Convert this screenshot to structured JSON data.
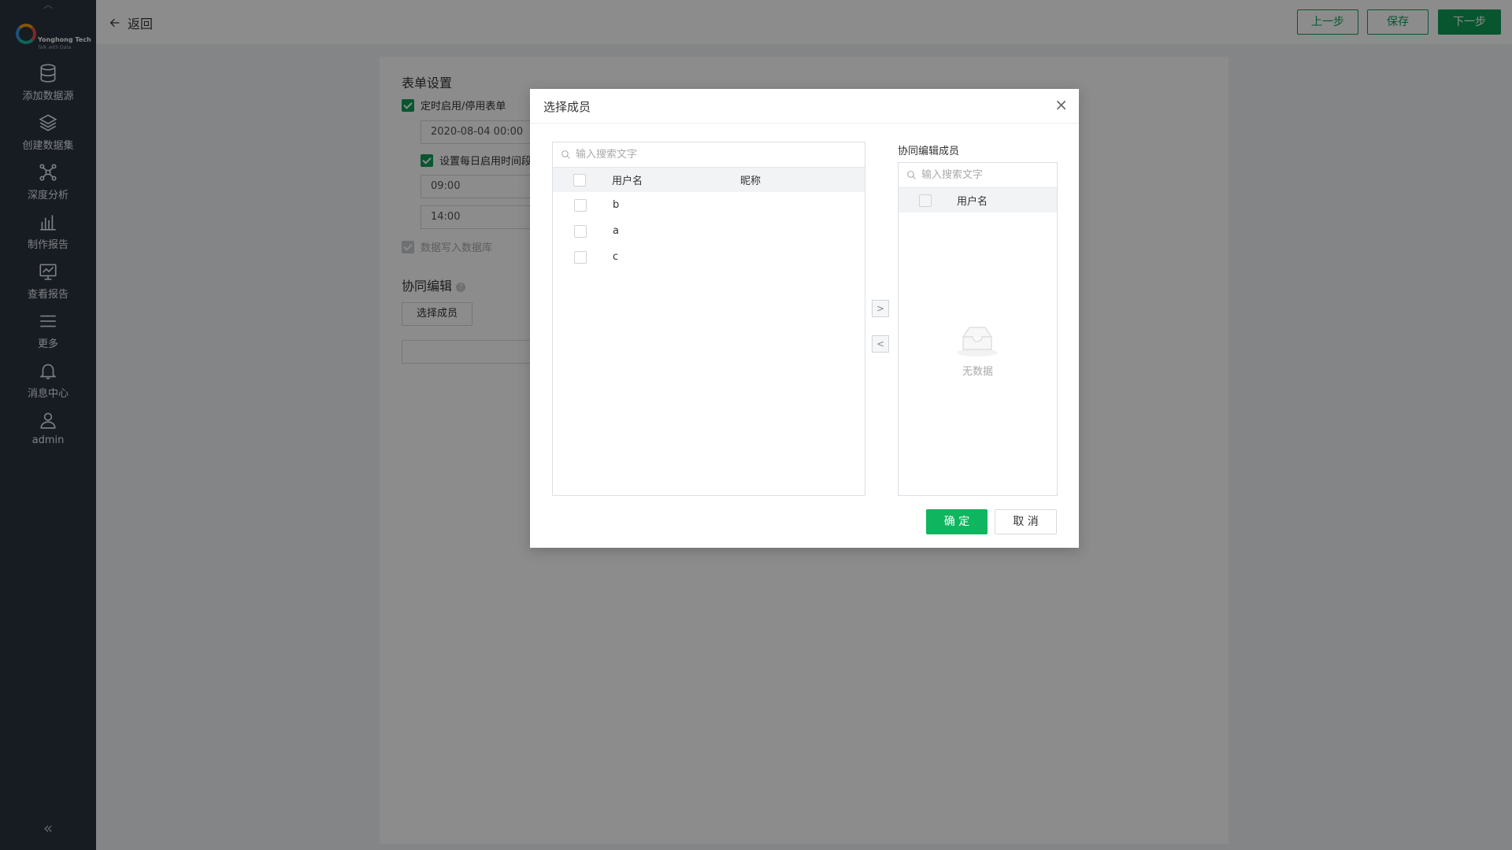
{
  "sidebar": {
    "logo": {
      "brand": "Yonghong Tech",
      "tagline": "Talk with Data"
    },
    "items": [
      {
        "label": "添加数据源",
        "icon": "database-icon"
      },
      {
        "label": "创建数据集",
        "icon": "layers-icon"
      },
      {
        "label": "深度分析",
        "icon": "network-icon"
      },
      {
        "label": "制作报告",
        "icon": "bar-chart-icon"
      },
      {
        "label": "查看报告",
        "icon": "monitor-chart-icon"
      },
      {
        "label": "更多",
        "icon": "menu-icon"
      },
      {
        "label": "消息中心",
        "icon": "bell-icon"
      },
      {
        "label": "admin",
        "icon": "user-icon"
      }
    ],
    "collapse_label": "«"
  },
  "topbar": {
    "back_label": "返回",
    "prev_label": "上一步",
    "save_label": "保存",
    "next_label": "下一步"
  },
  "form": {
    "section_title": "表单设置",
    "schedule_label": "定时启用/停用表单",
    "schedule_datetime": "2020-08-04 00:00",
    "daily_label": "设置每日启用时间段",
    "daily_start": "09:00",
    "daily_end": "14:00",
    "write_db_label": "数据写入数据库",
    "collab_title": "协同编辑",
    "select_members_label": "选择成员"
  },
  "modal": {
    "title": "选择成员",
    "close": "×",
    "left": {
      "search_placeholder": "输入搜索文字",
      "columns": [
        "用户名",
        "昵称"
      ],
      "rows": [
        {
          "username": "b",
          "nickname": ""
        },
        {
          "username": "a",
          "nickname": ""
        },
        {
          "username": "c",
          "nickname": ""
        }
      ]
    },
    "transfer": {
      "right_arrow": ">",
      "left_arrow": "<"
    },
    "right": {
      "title": "协同编辑成员",
      "search_placeholder": "输入搜索文字",
      "columns": [
        "用户名"
      ],
      "empty_text": "无数据"
    },
    "ok_label": "确 定",
    "cancel_label": "取 消"
  },
  "colors": {
    "sidebar_bg": "#2b3340",
    "primary_green": "#0f9d58",
    "ok_green": "#0fb65f"
  }
}
